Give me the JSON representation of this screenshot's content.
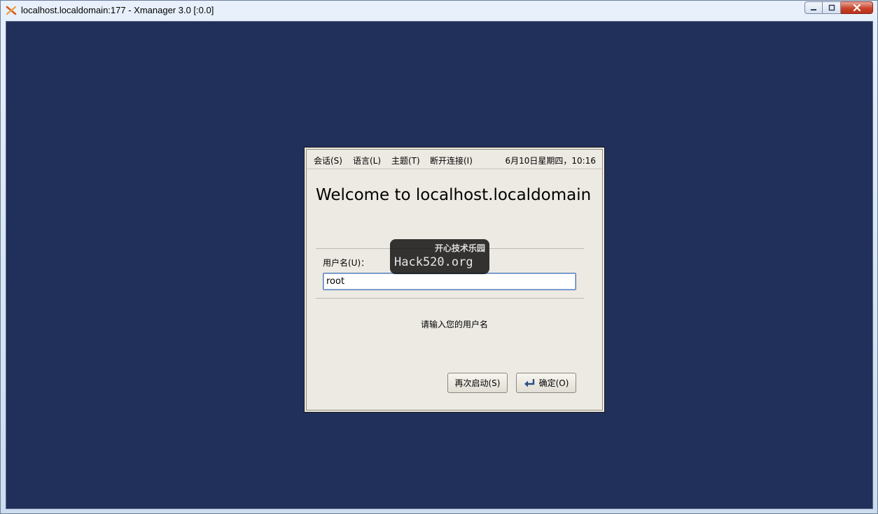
{
  "window": {
    "title": "localhost.localdomain:177 - Xmanager 3.0 [:0.0]",
    "app_icon": "xmanager-x-icon",
    "controls": {
      "minimize": "minimize-icon",
      "maximize": "maximize-icon",
      "close": "close-icon"
    }
  },
  "colors": {
    "desktop_bg": "#212f5b",
    "dialog_bg": "#edeae3",
    "input_border": "#4d7ab8"
  },
  "menubar": {
    "items": [
      {
        "label": "会话(S)"
      },
      {
        "label": "语言(L)"
      },
      {
        "label": "主题(T)"
      },
      {
        "label": "断开连接(I)"
      }
    ],
    "clock": "6月10日星期四，10:16"
  },
  "dialog": {
    "welcome": "Welcome to localhost.localdomain",
    "username_label": "用户名(U)：",
    "username_value": "root",
    "prompt": "请输入您的用户名",
    "restart_button": "再次启动(S)",
    "ok_button": "确定(O)",
    "ok_icon": "enter-arrow-icon"
  },
  "watermark": {
    "line1": "开心技术乐园",
    "line2": "Hack520.org"
  }
}
